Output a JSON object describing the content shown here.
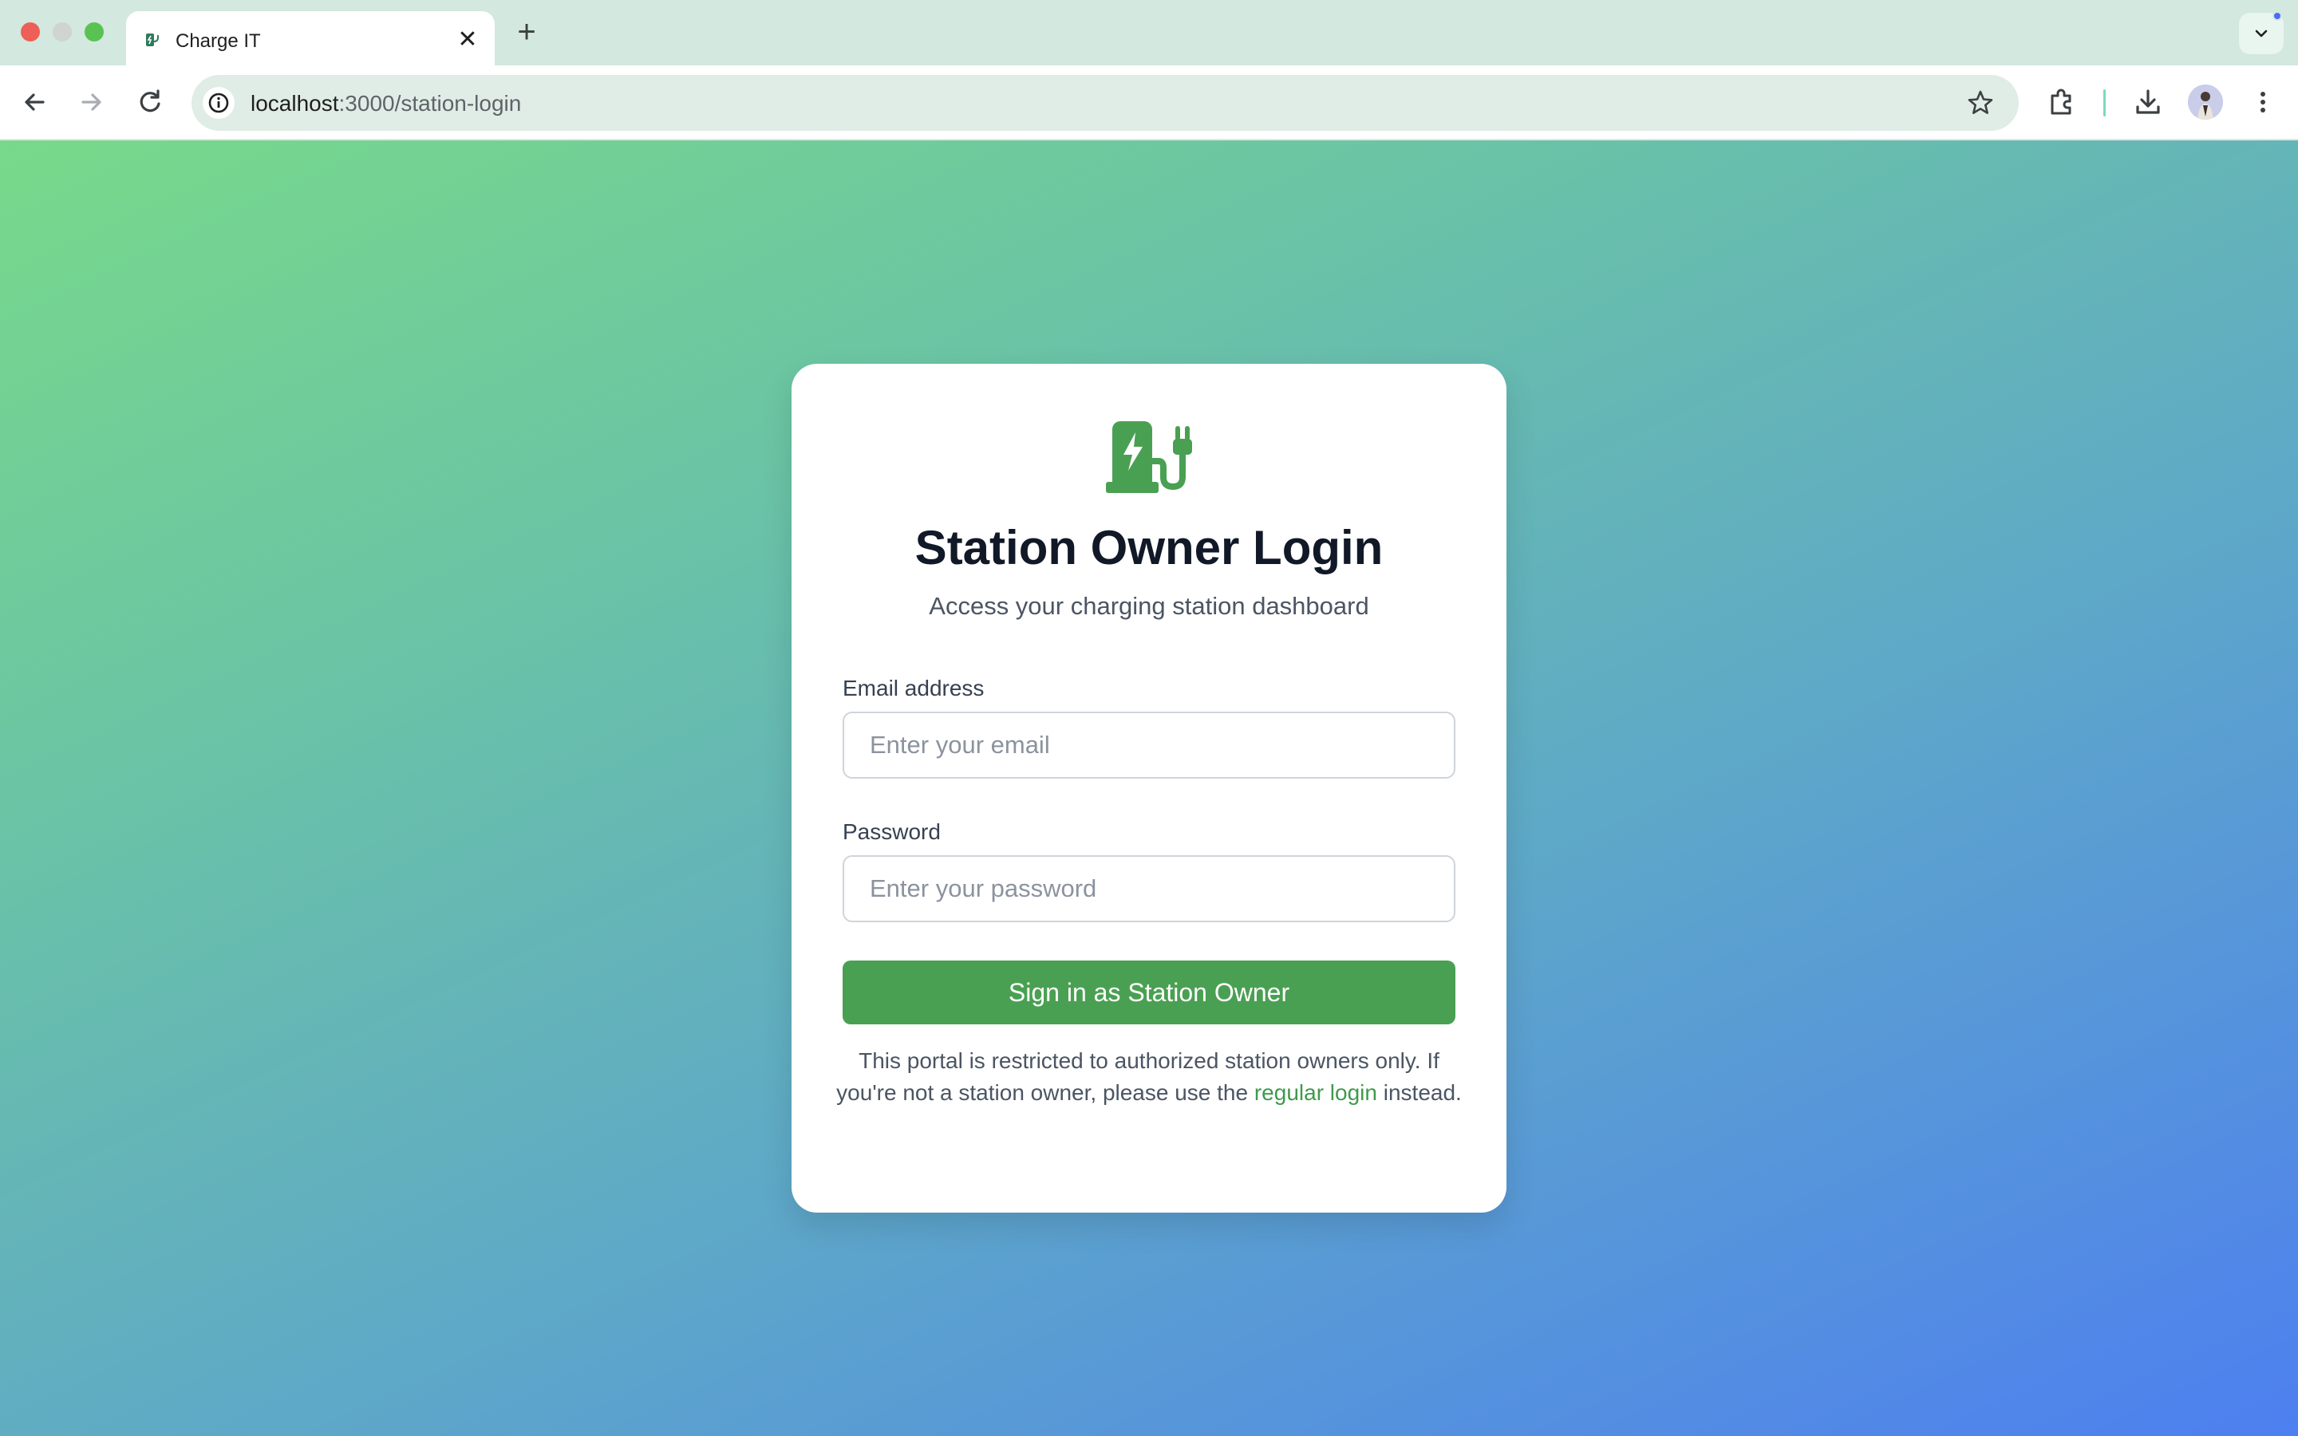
{
  "browser": {
    "tab_title": "Charge IT",
    "tab_close": "✕",
    "new_tab": "+",
    "url_host": "localhost",
    "url_rest": ":3000/station-login"
  },
  "page": {
    "title": "Station Owner Login",
    "subtitle": "Access your charging station dashboard",
    "email_label": "Email address",
    "email_placeholder": "Enter your email",
    "email_value": "",
    "password_label": "Password",
    "password_placeholder": "Enter your password",
    "password_value": "",
    "submit_label": "Sign in as Station Owner",
    "notice_before": "This portal is restricted to authorized station owners only. If you're not a station owner, please use the ",
    "notice_link": "regular login",
    "notice_after": " instead."
  },
  "colors": {
    "brand_green": "#4aa052",
    "link_green": "#3f9a4d",
    "gradient_start": "#78d98a",
    "gradient_end": "#4d7ff0"
  },
  "icons": [
    "back-arrow-icon",
    "forward-arrow-icon",
    "reload-icon",
    "site-info-icon",
    "bookmark-star-icon",
    "extensions-icon",
    "download-icon",
    "menu-dots-icon",
    "ev-charging-station-icon"
  ]
}
